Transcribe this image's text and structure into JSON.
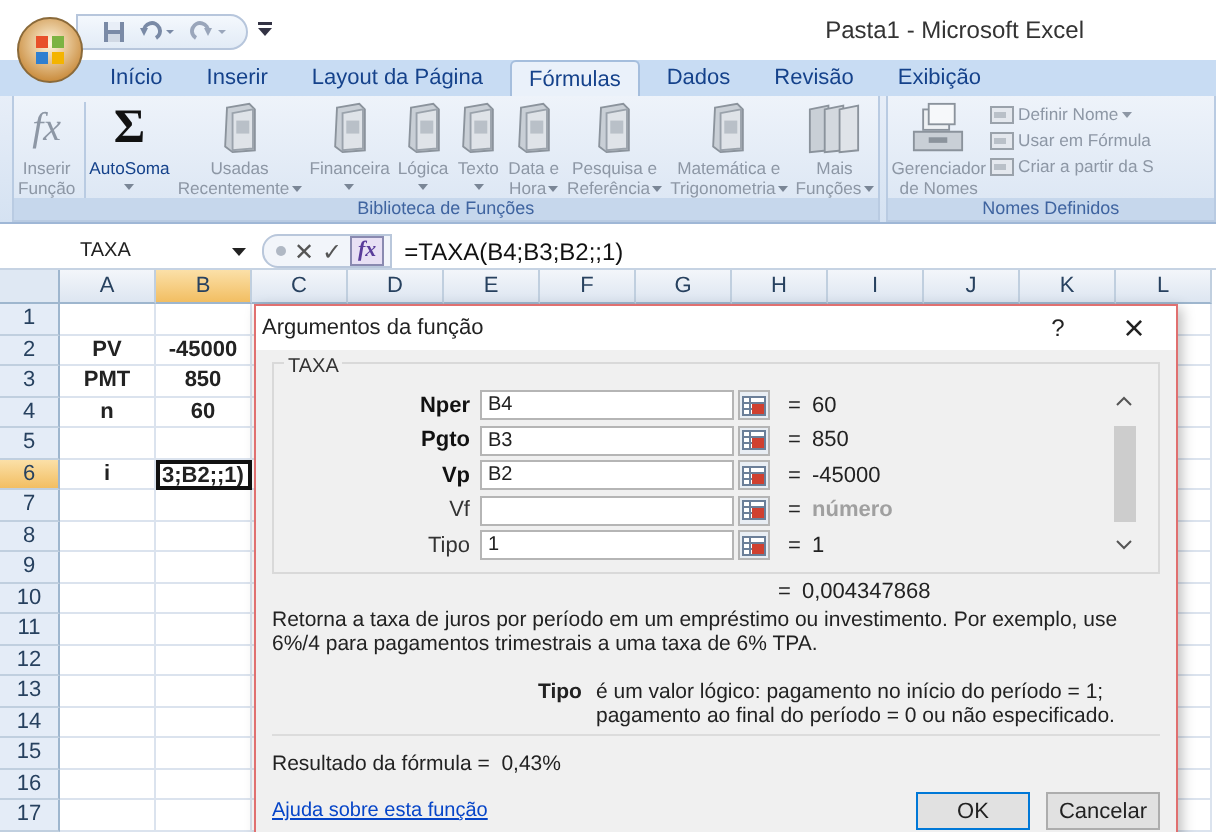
{
  "window": {
    "title": "Pasta1 - Microsoft Excel"
  },
  "ribbon_tabs": [
    {
      "label": "Início",
      "selected": false
    },
    {
      "label": "Inserir",
      "selected": false
    },
    {
      "label": "Layout da Página",
      "selected": false
    },
    {
      "label": "Fórmulas",
      "selected": true
    },
    {
      "label": "Dados",
      "selected": false
    },
    {
      "label": "Revisão",
      "selected": false
    },
    {
      "label": "Exibição",
      "selected": false
    }
  ],
  "ribbon_groups": [
    {
      "label": "Biblioteca de Funções",
      "buttons": [
        {
          "kind": "glyph",
          "glyph": "fx",
          "lines": [
            "Inserir",
            "Função"
          ],
          "dropdown": false,
          "disabled": true
        },
        {
          "kind": "glyph",
          "glyph": "Σ",
          "lines": [
            "AutoSoma"
          ],
          "dropdown": true,
          "disabled": false
        },
        {
          "kind": "book",
          "lines": [
            "Usadas",
            "Recentemente"
          ],
          "dropdown": true,
          "disabled": true
        },
        {
          "kind": "book",
          "lines": [
            "Financeira"
          ],
          "dropdown": true,
          "disabled": true
        },
        {
          "kind": "book",
          "lines": [
            "Lógica"
          ],
          "dropdown": true,
          "disabled": true
        },
        {
          "kind": "book",
          "lines": [
            "Texto"
          ],
          "dropdown": true,
          "disabled": true
        },
        {
          "kind": "book",
          "lines": [
            "Data e",
            "Hora"
          ],
          "dropdown": true,
          "disabled": true
        },
        {
          "kind": "book",
          "lines": [
            "Pesquisa e",
            "Referência"
          ],
          "dropdown": true,
          "disabled": true
        },
        {
          "kind": "book",
          "lines": [
            "Matemática e",
            "Trigonometria"
          ],
          "dropdown": true,
          "disabled": true
        },
        {
          "kind": "books",
          "lines": [
            "Mais",
            "Funções"
          ],
          "dropdown": true,
          "disabled": true
        }
      ]
    },
    {
      "label": "Nomes Definidos",
      "buttons": [
        {
          "kind": "cabinet",
          "lines": [
            "Gerenciador",
            "de Nomes"
          ],
          "dropdown": false,
          "disabled": true
        },
        {
          "kind": "small",
          "lines": [
            "Definir Nome"
          ],
          "dropdown": true,
          "disabled": true
        },
        {
          "kind": "small",
          "lines": [
            "Usar em Fórmula"
          ],
          "dropdown": false,
          "disabled": true
        },
        {
          "kind": "small",
          "lines": [
            "Criar a partir da S"
          ],
          "dropdown": false,
          "disabled": true
        }
      ]
    }
  ],
  "formula_bar": {
    "name_box": "TAXA",
    "cancel": "✕",
    "enter": "✓",
    "function_button": "fx",
    "formula": "=TAXA(B4;B3;B2;;1)"
  },
  "columns": [
    {
      "label": "A",
      "selected": false
    },
    {
      "label": "B",
      "selected": true
    },
    {
      "label": "C",
      "selected": false
    },
    {
      "label": "D",
      "selected": false
    },
    {
      "label": "E",
      "selected": false
    },
    {
      "label": "F",
      "selected": false
    },
    {
      "label": "G",
      "selected": false
    },
    {
      "label": "H",
      "selected": false
    },
    {
      "label": "I",
      "selected": false
    },
    {
      "label": "J",
      "selected": false
    },
    {
      "label": "K",
      "selected": false
    },
    {
      "label": "L",
      "selected": false
    }
  ],
  "rows": [
    {
      "label": "1",
      "selected": false,
      "cells": [
        {
          "active": false
        },
        {
          "active": false
        }
      ]
    },
    {
      "label": "2",
      "selected": false,
      "cells": [
        {
          "text": "PV",
          "active": false
        },
        {
          "text": "-45000",
          "active": false
        }
      ]
    },
    {
      "label": "3",
      "selected": false,
      "cells": [
        {
          "text": "PMT",
          "active": false
        },
        {
          "text": "850",
          "active": false
        }
      ]
    },
    {
      "label": "4",
      "selected": false,
      "cells": [
        {
          "text": "n",
          "active": false
        },
        {
          "text": "60",
          "active": false
        }
      ]
    },
    {
      "label": "5",
      "selected": false,
      "cells": [
        {
          "active": false
        },
        {
          "active": false
        }
      ]
    },
    {
      "label": "6",
      "selected": true,
      "cells": [
        {
          "text": "i",
          "active": false
        },
        {
          "text": "3;B2;;1)",
          "active": true
        }
      ]
    },
    {
      "label": "7",
      "selected": false,
      "cells": [
        {
          "active": false
        },
        {
          "active": false
        }
      ]
    },
    {
      "label": "8",
      "selected": false,
      "cells": [
        {
          "active": false
        },
        {
          "active": false
        }
      ]
    },
    {
      "label": "9",
      "selected": false,
      "cells": [
        {
          "active": false
        },
        {
          "active": false
        }
      ]
    },
    {
      "label": "10",
      "selected": false,
      "cells": [
        {
          "active": false
        },
        {
          "active": false
        }
      ]
    },
    {
      "label": "11",
      "selected": false,
      "cells": [
        {
          "active": false
        },
        {
          "active": false
        }
      ]
    },
    {
      "label": "12",
      "selected": false,
      "cells": [
        {
          "active": false
        },
        {
          "active": false
        }
      ]
    },
    {
      "label": "13",
      "selected": false,
      "cells": [
        {
          "active": false
        },
        {
          "active": false
        }
      ]
    },
    {
      "label": "14",
      "selected": false,
      "cells": [
        {
          "active": false
        },
        {
          "active": false
        }
      ]
    },
    {
      "label": "15",
      "selected": false,
      "cells": [
        {
          "active": false
        },
        {
          "active": false
        }
      ]
    },
    {
      "label": "16",
      "selected": false,
      "cells": [
        {
          "active": false
        },
        {
          "active": false
        }
      ]
    },
    {
      "label": "17",
      "selected": false,
      "cells": [
        {
          "active": false
        },
        {
          "active": false
        }
      ]
    }
  ],
  "dialog": {
    "title": "Argumentos da função",
    "help": "?",
    "close": "×",
    "function_name": "TAXA",
    "arguments": [
      {
        "name": "Nper",
        "value": "B4",
        "equals": "=",
        "result": "60",
        "required": true,
        "result_dimmed": false
      },
      {
        "name": "Pgto",
        "value": "B3",
        "equals": "=",
        "result": "850",
        "required": true,
        "result_dimmed": false
      },
      {
        "name": "Vp",
        "value": "B2",
        "equals": "=",
        "result": "-45000",
        "required": true,
        "result_dimmed": false
      },
      {
        "name": "Vf",
        "equals": "=",
        "result": "número",
        "required": false,
        "result_dimmed": true
      },
      {
        "name": "Tipo",
        "value": "1",
        "equals": "=",
        "result": "1",
        "required": false,
        "result_dimmed": false
      }
    ],
    "total_equals": "=",
    "total": "0,004347868",
    "description": "Retorna a taxa de juros por período em um empréstimo ou investimento. Por exemplo, use 6%/4 para pagamentos trimestrais a uma taxa de 6% TPA.",
    "argument_help": {
      "name": "Tipo",
      "text": "é um valor lógico: pagamento no início do período = 1; pagamento ao final do período = 0 ou não especificado."
    },
    "result_label": "Resultado da fórmula =",
    "result_value": "0,43%",
    "help_link": "Ajuda sobre esta função",
    "buttons": [
      {
        "label": "OK",
        "default": true
      },
      {
        "label": "Cancelar",
        "default": false
      }
    ]
  }
}
